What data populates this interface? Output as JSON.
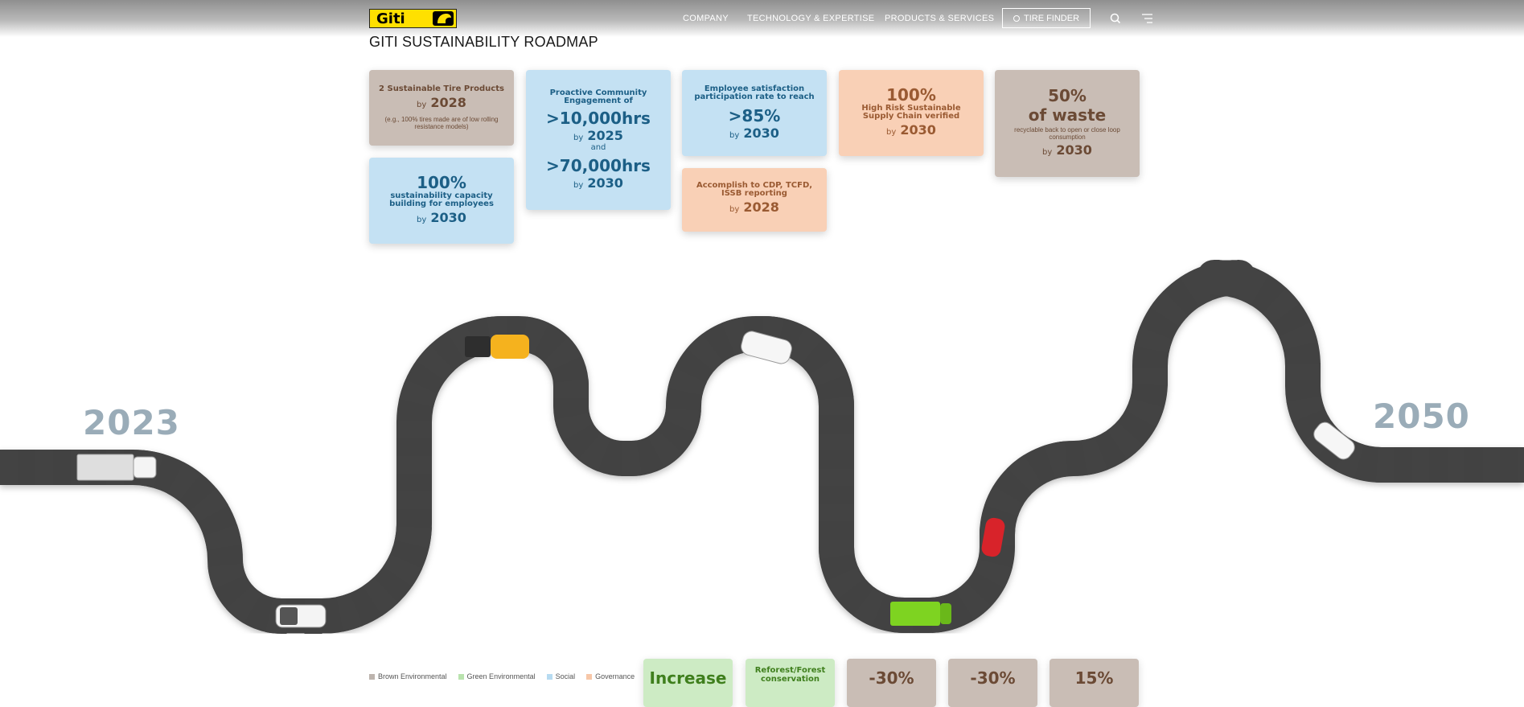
{
  "header": {
    "logo_text": "Giti",
    "nav": [
      "COMPANY",
      "TECHNOLOGY & EXPERTISE",
      "PRODUCTS & SERVICES"
    ],
    "tire_finder_label": "TIRE FINDER"
  },
  "page_title": "GITI SUSTAINABILITY ROADMAP",
  "cards": {
    "tire_products": {
      "head": "2 Sustainable Tire Products",
      "by": "by",
      "year": "2028",
      "note": "(e.g., 100% tires made are of low rolling resistance models)"
    },
    "capacity": {
      "big": "100%",
      "head": "sustainability capacity building for employees",
      "by": "by",
      "year": "2030"
    },
    "community": {
      "head": "Proactive Community Engagement of",
      "big1": ">10,000hrs",
      "by1": "by",
      "year1": "2025",
      "and": "and",
      "big2": ">70,000hrs",
      "by2": "by",
      "year2": "2030"
    },
    "employee": {
      "head": "Employee satisfaction participation rate to reach",
      "big": ">85%",
      "by": "by",
      "year": "2030"
    },
    "reporting": {
      "head": "Accomplish to CDP, TCFD, ISSB reporting",
      "by": "by",
      "year": "2028"
    },
    "supply_chain": {
      "big": "100%",
      "head": "High Risk Sustainable Supply Chain verified",
      "by": "by",
      "year": "2030"
    },
    "waste": {
      "big1": "50%",
      "big2": "of waste",
      "note": "recyclable back to open or close loop consumption",
      "by": "by",
      "year": "2030"
    }
  },
  "timeline": {
    "start_year": "2023",
    "end_year": "2050"
  },
  "legend": [
    {
      "label": "Brown Environmental",
      "color": "#bdb4ae"
    },
    {
      "label": "Green Environmental",
      "color": "#b9e3ae"
    },
    {
      "label": "Social",
      "color": "#b7dbf1"
    },
    {
      "label": "Governance",
      "color": "#f7c7a8"
    }
  ],
  "bottom_cards": [
    "Increase",
    "Reforest/Forest conservation",
    "-30%",
    "-30%",
    "15%"
  ],
  "colors": {
    "road": "#434343",
    "year_label": "#9aacb8"
  }
}
